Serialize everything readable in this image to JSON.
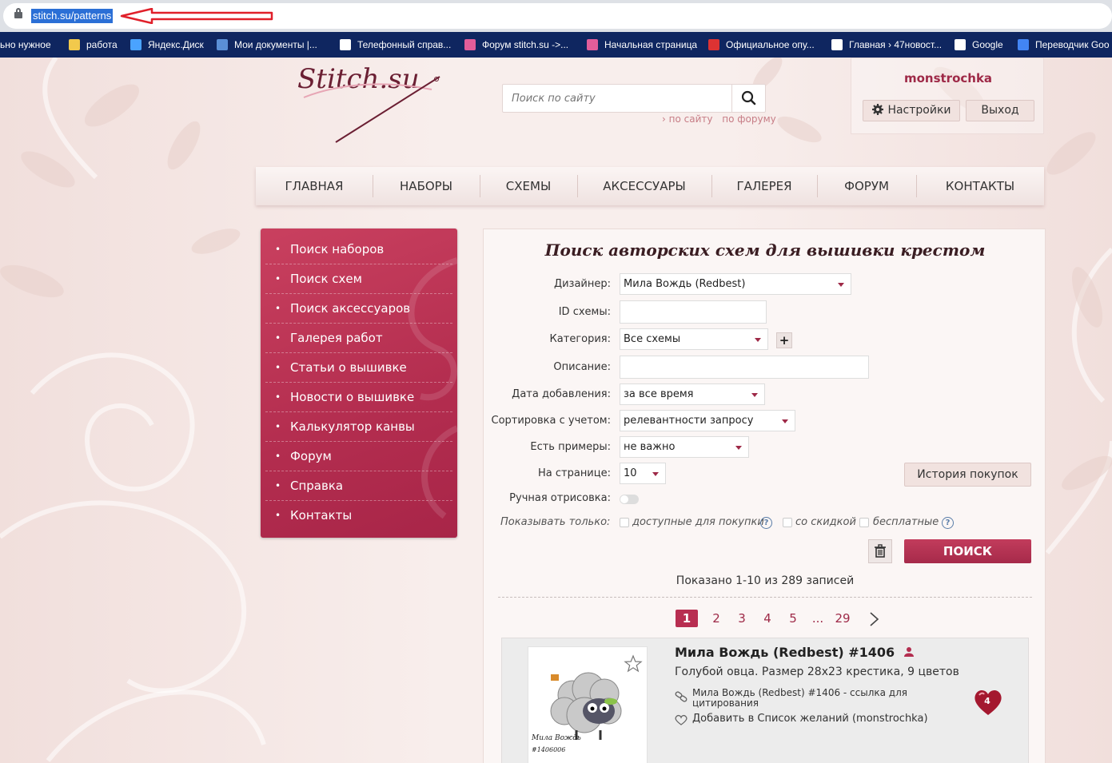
{
  "browser": {
    "url": "stitch.su/patterns",
    "bookmarks": [
      {
        "label": "ьно нужное",
        "icon": "bookmark-icon",
        "color": "#0f2660"
      },
      {
        "label": "работа",
        "icon": "folder-icon",
        "color": "#f2c94c"
      },
      {
        "label": "Яндекс.Диск",
        "icon": "yandex-disk-icon",
        "color": "#4aa3ff"
      },
      {
        "label": "Мои документы |...",
        "icon": "documents-icon",
        "color": "#5b8fd6"
      },
      {
        "label": "Телефонный справ...",
        "icon": "globe-icon",
        "color": "#ffffff"
      },
      {
        "label": "Форум stitch.su ->...",
        "icon": "stitch-icon",
        "color": "#e35d9a"
      },
      {
        "label": "Начальная страница",
        "icon": "stitch-icon",
        "color": "#e35d9a"
      },
      {
        "label": "Официальное опу...",
        "icon": "flag-icon",
        "color": "#d33"
      },
      {
        "label": "Главная › 47новост...",
        "icon": "news47-icon",
        "color": "#ffffff"
      },
      {
        "label": "Google",
        "icon": "google-icon",
        "color": "#ffffff"
      },
      {
        "label": "Переводчик Goo",
        "icon": "translate-icon",
        "color": "#4285f4"
      }
    ]
  },
  "header": {
    "search_placeholder": "Поиск по сайту",
    "scope_site": "› по сайту",
    "scope_forum": "по форуму",
    "username": "monstrochka",
    "settings_label": "Настройки",
    "logout_label": "Выход"
  },
  "nav": [
    "ГЛАВНАЯ",
    "НАБОРЫ",
    "СХЕМЫ",
    "АКСЕССУАРЫ",
    "ГАЛЕРЕЯ",
    "ФОРУМ",
    "КОНТАКТЫ"
  ],
  "sidebar": [
    "Поиск наборов",
    "Поиск схем",
    "Поиск аксессуаров",
    "Галерея работ",
    "Статьи о вышивке",
    "Новости о вышивке",
    "Калькулятор канвы",
    "Форум",
    "Справка",
    "Контакты"
  ],
  "form": {
    "title": "Поиск авторских схем для вышивки крестом",
    "designer_label": "Дизайнер:",
    "designer_value": "Мила Вождь (Redbest)",
    "id_label": "ID схемы:",
    "category_label": "Категория:",
    "category_value": "Все схемы",
    "description_label": "Описание:",
    "date_label": "Дата добавления:",
    "date_value": "за все время",
    "sort_label": "Сортировка с учетом:",
    "sort_value": "релевантности запросу",
    "examples_label": "Есть примеры:",
    "examples_value": "не важно",
    "perpage_label": "На странице:",
    "perpage_value": "10",
    "history_button": "История покупок",
    "manual_label": "Ручная отрисовка:",
    "show_only_label": "Показывать только:",
    "filter_available": "доступные для покупки",
    "filter_discount": "со скидкой",
    "filter_free": "бесплатные",
    "search_button": "ПОИСК"
  },
  "results": {
    "summary": "Показано 1-10 из 289 записей",
    "pages": [
      "1",
      "2",
      "3",
      "4",
      "5",
      "...",
      "29"
    ],
    "current_page": "1",
    "item": {
      "title": "Мила Вождь (Redbest) #1406",
      "description": "Голубой овца. Размер 28x23 крестика, 9 цветов",
      "cite_link": "Мила Вождь (Redbest) #1406 - ссылка для цитирования",
      "wishlist": "Добавить в Список желаний (monstrochka)",
      "likes": "4",
      "thumb_caption_1": "Мила Вождь",
      "thumb_caption_2": "#1406006"
    }
  },
  "colors": {
    "brand": "#b32d4f",
    "bookmarks_bar": "#0f2660",
    "annotation_arrow": "#e0202a"
  }
}
